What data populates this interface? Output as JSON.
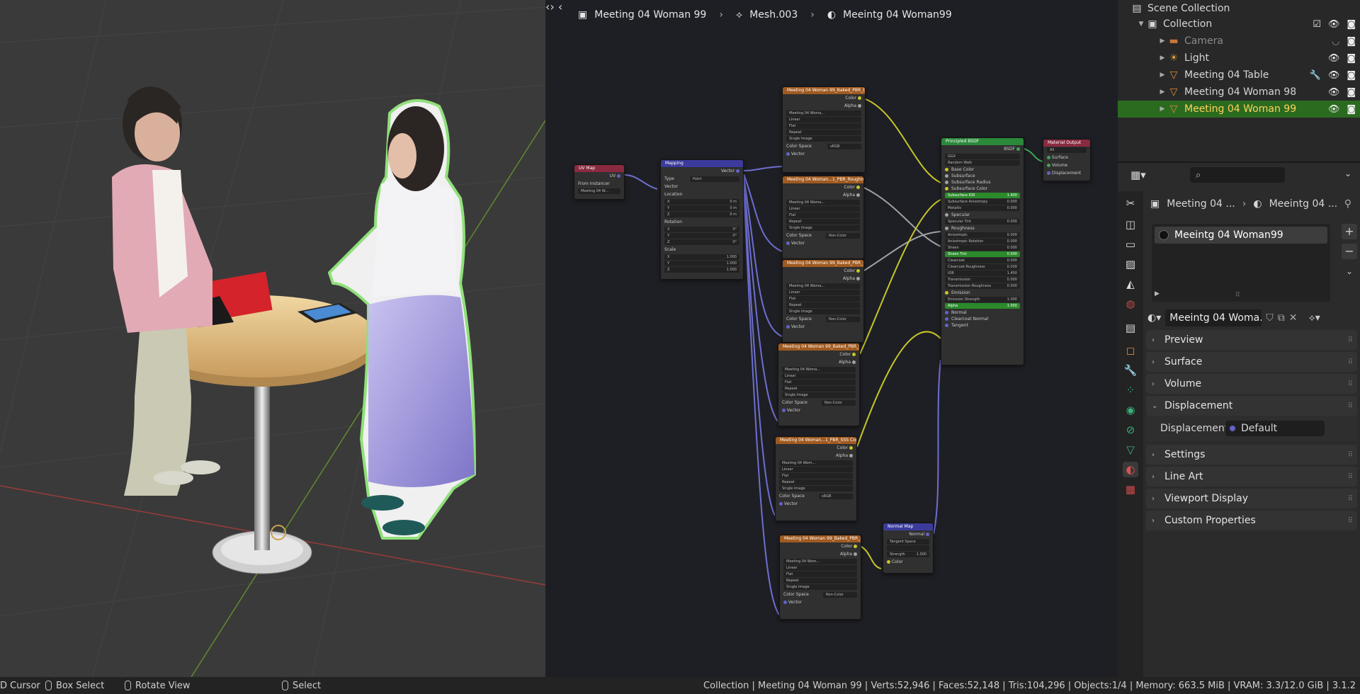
{
  "node_editor": {
    "breadcrumb": [
      "Meeting 04 Woman 99",
      "Mesh.003",
      "Meeintg 04 Woman99"
    ],
    "nodes": {
      "uvmap": {
        "title": "UV Map",
        "out": "UV",
        "from_instancer": "From Instancer",
        "map": "Meeting 04 W..."
      },
      "mapping": {
        "title": "Mapping",
        "out": "Vector",
        "type_label": "Type",
        "type_value": "Point",
        "vector": "Vector",
        "location": "Location",
        "rotation": "Rotation",
        "scale": "Scale",
        "loc_vals": [
          "0 m",
          "0 m",
          "0 m"
        ],
        "rot_vals": [
          "0°",
          "0°",
          "0°"
        ],
        "scale_vals": [
          "1.000",
          "1.000",
          "1.000"
        ],
        "axes": [
          "X",
          "Y",
          "Z"
        ]
      },
      "textures": [
        {
          "title": "Meeting 04 Woman 99_Baked_PBR_Diffus...",
          "image": "Meeting 04 Woma...",
          "color_space": "sRGB"
        },
        {
          "title": "Meeting 04 Woman...1_PBR_Roughness.jpg",
          "image": "Meeting 04 Woma...",
          "color_space": "Non-Color"
        },
        {
          "title": "Meeting 04 Woman 99_Baked_PBR_Specu...",
          "image": "Meeting 04 Woma...",
          "color_space": "Non-Color"
        },
        {
          "title": "Meeting 04 Woman 99_Baked_PBR_SSSdi...",
          "image": "Meeting 04 Woma...",
          "color_space": "Non-Color"
        },
        {
          "title": "Meeting 04 Woman...1_PBR_SSS Colour.jpg",
          "image": "Meeting 04 Wom...",
          "color_space": "sRGB"
        },
        {
          "title": "Meeting 04 Woman 99_Baked_PBR_Norm...",
          "image": "Meeting 04 Wom...",
          "color_space": "Non-Color"
        }
      ],
      "tex_labels": {
        "color": "Color",
        "alpha": "Alpha",
        "interp": "Linear",
        "proj": "Flat",
        "ext": "Repeat",
        "src": "Single Image",
        "cs": "Color Space",
        "vector": "Vector"
      },
      "bsdf": {
        "title": "Principled BSDF",
        "out": "BSDF",
        "dist": "GGX",
        "sss": "Random Walk",
        "inputs": [
          {
            "label": "Base Color"
          },
          {
            "label": "Subsurface"
          },
          {
            "label": "Subsurface Radius"
          },
          {
            "label": "Subsurface Color"
          },
          {
            "label": "Subsurface IOR",
            "value": "1.400",
            "green": true
          },
          {
            "label": "Subsurface Anisotropy",
            "value": "0.000"
          },
          {
            "label": "Metallic",
            "value": "0.000"
          },
          {
            "label": "Specular"
          },
          {
            "label": "Specular Tint",
            "value": "0.000"
          },
          {
            "label": "Roughness"
          },
          {
            "label": "Anisotropic",
            "value": "0.000"
          },
          {
            "label": "Anisotropic Rotation",
            "value": "0.000"
          },
          {
            "label": "Sheen",
            "value": "0.000"
          },
          {
            "label": "Sheen Tint",
            "value": "0.500",
            "green": true
          },
          {
            "label": "Clearcoat",
            "value": "0.000"
          },
          {
            "label": "Clearcoat Roughness",
            "value": "0.030"
          },
          {
            "label": "IOR",
            "value": "1.450"
          },
          {
            "label": "Transmission",
            "value": "0.000"
          },
          {
            "label": "Transmission Roughness",
            "value": "0.000"
          },
          {
            "label": "Emission"
          },
          {
            "label": "Emission Strength",
            "value": "1.000"
          },
          {
            "label": "Alpha",
            "value": "1.000",
            "green": true
          },
          {
            "label": "Normal"
          },
          {
            "label": "Clearcoat Normal"
          },
          {
            "label": "Tangent"
          }
        ]
      },
      "output": {
        "title": "Material Output",
        "target": "All",
        "surface": "Surface",
        "volume": "Volume",
        "displacement": "Displacement"
      },
      "normal_map": {
        "title": "Normal Map",
        "out": "Normal",
        "space": "Tangent Space",
        "strength_label": "Strength",
        "strength": "1.000",
        "color": "Color"
      }
    }
  },
  "outliner": {
    "root": "Scene Collection",
    "collection": "Collection",
    "items": [
      {
        "label": "Camera",
        "type": "camera"
      },
      {
        "label": "Light",
        "type": "light"
      },
      {
        "label": "Meeting 04 Table",
        "type": "mesh"
      },
      {
        "label": "Meeting 04 Woman 98",
        "type": "mesh"
      },
      {
        "label": "Meeting 04 Woman 99",
        "type": "mesh"
      }
    ]
  },
  "properties": {
    "search_placeholder": "",
    "crumb_object": "Meeting 04 ...",
    "crumb_material": "Meeintg 04 ...",
    "slot_name": "Meeintg 04 Woman99",
    "material_field": "Meeintg 04 Woma...",
    "panels": [
      "Preview",
      "Surface",
      "Volume",
      "Displacement",
      "Settings",
      "Line Art",
      "Viewport Display",
      "Custom Properties"
    ],
    "displacement_label": "Displacement",
    "displacement_value": "Default"
  },
  "statusbar": {
    "cursor": "D Cursor",
    "box_select": "Box Select",
    "rotate_view": "Rotate View",
    "select": "Select",
    "stats": "Collection | Meeting 04 Woman 99 | Verts:52,946 | Faces:52,148 | Tris:104,296 | Objects:1/4 | Memory: 663.5 MiB | VRAM: 3.3/12.0 GiB | 3.1.2"
  }
}
